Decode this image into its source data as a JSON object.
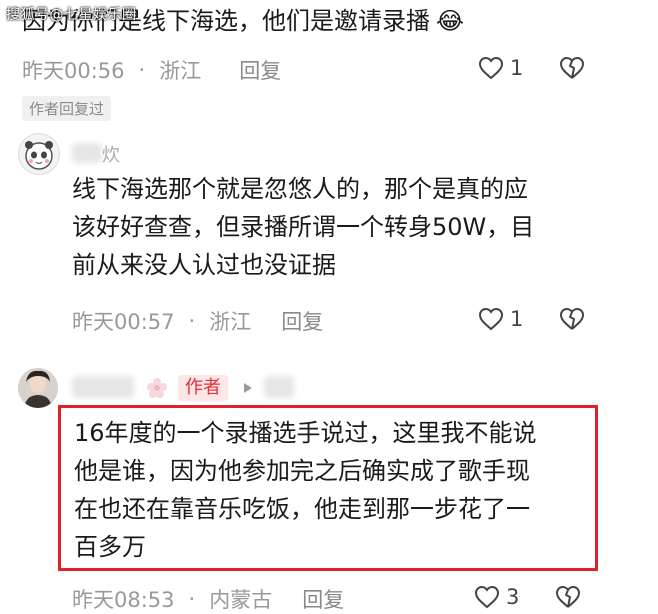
{
  "watermark": "搜狐号@七星娱乐圈",
  "comment1": {
    "text": "因为你们是线下海选，他们是邀请录播",
    "emoji": "😂",
    "time": "昨天00:56",
    "location": "浙江",
    "reply": "回复",
    "likes": "1",
    "author_replied": "作者回复过"
  },
  "comment2": {
    "username": "炊",
    "lines": [
      "线下海选那个就是忽悠人的，那个是真的应",
      "该好好查查，但录播所谓一个转身50W，目",
      "前从来没人认过也没证据"
    ],
    "time": "昨天00:57",
    "location": "浙江",
    "reply": "回复",
    "likes": "1"
  },
  "comment3": {
    "author_tag": "作者",
    "lines": [
      "16年度的一个录播选手说过，这里我不能说",
      "他是谁，因为他参加完之后确实成了歌手现",
      "在也还在靠音乐吃饭，他走到那一步花了一",
      "百多万"
    ],
    "time": "昨天08:53",
    "location": "内蒙古",
    "reply": "回复",
    "likes": "3"
  },
  "separator": "·",
  "colors": {
    "text": "#1a1a1a",
    "meta": "#999999",
    "author_tag_bg": "#fde6e6",
    "author_tag_text": "#e1303a",
    "highlight_border": "#e0212b"
  }
}
